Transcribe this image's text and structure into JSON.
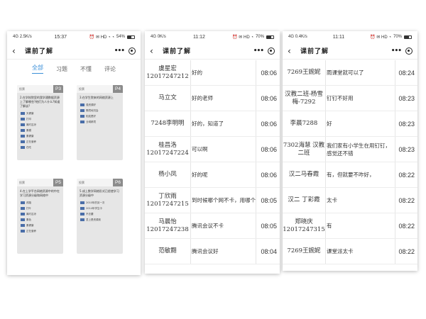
{
  "screens": [
    {
      "status": {
        "carrier": "4G",
        "speed": "2.5K/s",
        "time": "15:37",
        "icons": "⏰ ✉ HD ◔ ◔",
        "battery": "54%",
        "battery_level": 0.54
      },
      "title": "课前了解",
      "tabs": [
        "全部",
        "习题",
        "不懂",
        "评论"
      ],
      "cards": [
        {
          "header": "投票",
          "badge": "P3",
          "question": "2.在学校院里的我学通数据资源上了解哪些?他们为人什么?知道了解谈?",
          "options": [
            "天健康",
            "打印",
            "离时吉凉",
            "素模",
            "素健康",
            "正在营养",
            "在吃"
          ]
        },
        {
          "header": "投票",
          "badge": "P4",
          "question": "3.在学生院来的网络资源上",
          "options": [
            "强资源好",
            "隔境地况会",
            "相连是好",
            "业域精境"
          ]
        },
        {
          "header": "投票",
          "badge": "P5",
          "question": "4.在上学平台网络资源中的中在学习资源分级和网络中",
          "options": [
            "改路",
            "打叶",
            "离时吉凉",
            "素色",
            "素健康",
            "正在营养"
          ]
        },
        {
          "header": "投票",
          "badge": "P6",
          "question": "5.成上数学网络形式已经使学习资源分级中",
          "options": [
            "2010年的另一次",
            "2014年学生中",
            "不去腰",
            "坚上是资源到"
          ]
        }
      ]
    },
    {
      "status": {
        "carrier": "4G",
        "speed": "0K/s",
        "time": "11:12",
        "icons": "⏰ ✉ HD ◔",
        "battery": "70%",
        "battery_level": 0.7
      },
      "title": "课前了解",
      "rows": [
        {
          "name": "虞星宏\n12017247212",
          "msg": "好的",
          "time": "08:06"
        },
        {
          "name": "马立文",
          "msg": "好的老师",
          "time": "08:06"
        },
        {
          "name": "7248李明明",
          "msg": "好的，知道了",
          "time": "08:06"
        },
        {
          "name": "桂昌洛\n12017247224",
          "msg": "可以啊",
          "time": "08:06"
        },
        {
          "name": "杨小凤",
          "msg": "好的呢",
          "time": "08:06"
        },
        {
          "name": "丁欣雨\n12017247215",
          "msg": "到时候哪个网不卡，用哪个",
          "time": "08:05"
        },
        {
          "name": "马晨怡\n12017247238",
          "msg": "腾讯会议不卡",
          "time": "08:05"
        },
        {
          "name": "范敏翾",
          "msg": "腾讯会议好",
          "time": "08:04"
        }
      ]
    },
    {
      "status": {
        "carrier": "4G",
        "speed": "0.4K/s",
        "time": "11:11",
        "icons": "⏰ ✉ HD ◔",
        "battery": "70%",
        "battery_level": 0.7
      },
      "title": "课前了解",
      "rows": [
        {
          "name": "7269王婉妮",
          "msg": "雨课堂就可以了",
          "time": "08:24"
        },
        {
          "name": "汉教二班-杨雪梅-7292",
          "msg": "钉钉不好用",
          "time": "08:23"
        },
        {
          "name": "李晨7288",
          "msg": "好",
          "time": "08:23"
        },
        {
          "name": "7302海慧 汉教二班",
          "msg": "我们家有小学生在用钉钉，感觉还不错",
          "time": "08:23"
        },
        {
          "name": "汉二马春霞",
          "msg": "有，但就要不咋好，",
          "time": "08:22"
        },
        {
          "name": "汉二 丁彩霞",
          "msg": "太卡",
          "time": "08:22"
        },
        {
          "name": "郑晓庆\n12017247315",
          "msg": "有",
          "time": "08:22"
        },
        {
          "name": "7269王婉妮",
          "msg": "课堂派太卡",
          "time": "08:22"
        }
      ]
    }
  ]
}
